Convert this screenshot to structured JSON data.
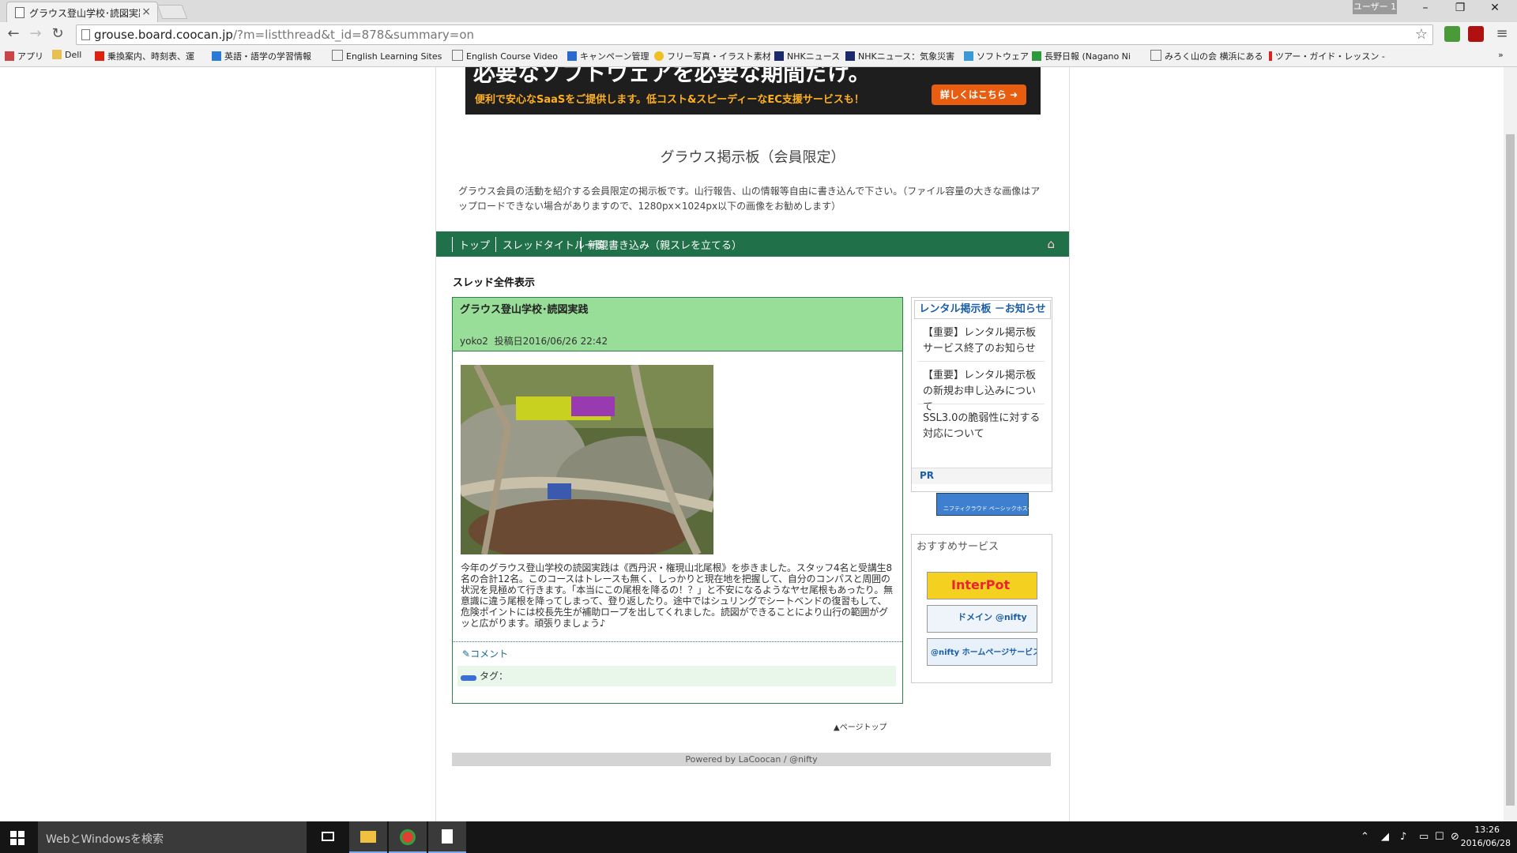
{
  "browser": {
    "tab_title": "グラウス登山学校･読図実践",
    "user_badge": "ユーザー 1",
    "url_host": "grouse.board.coocan.jp",
    "url_path": "/?m=listthread&t_id=878&summary=on",
    "bookmarks": [
      "アプリ",
      "Dell",
      "乗換案内、時刻表、運",
      "英語・語学の学習情報",
      "English Learning Sites",
      "English Course Video",
      "キャンペーン管理",
      "フリー写真・イラスト素材",
      "NHKニュース",
      "NHKニュース：気象災害",
      "ソフトウェア",
      "長野日報 (Nagano Ni",
      "みろく山の会 横浜にある",
      "ツアー・ガイド・レッスン -"
    ]
  },
  "banner": {
    "headline": "必要なソフトウェアを必要な期間だけ。",
    "sub": "便利で安心なSaaSをご提供します。低コスト&スピーディーなEC支援サービスも！",
    "button": "詳しくはこちら"
  },
  "board": {
    "title": "グラウス掲示板（会員限定）",
    "description": "グラウス会員の活動を紹介する会員限定の掲示板です。山行報告、山の情報等自由に書き込んで下さい。（ファイル容量の大きな画像はアップロードできない場合がありますので、1280px×1024px以下の画像をお勧めします）",
    "nav": [
      "トップ",
      "スレッドタイトル一覧",
      "新規書き込み（親スレを立てる）"
    ]
  },
  "section_title": "スレッド全件表示",
  "thread": {
    "title": "グラウス登山学校･読図実践",
    "author": "yoko2",
    "posted_label": "投稿日",
    "posted_at": "2016/06/26 22:42",
    "body": "今年のグラウス登山学校の読図実践は《西丹沢・権現山北尾根》を歩きました。スタッフ4名と受講生8名の合計12名。このコースはトレースも無く、しっかりと現在地を把握して、自分のコンパスと周囲の状況を見極めて行きます。「本当にこの尾根を降るの！？」と不安になるようなヤセ尾根もあったり。無意識に違う尾根を降ってしまって、登り返したり。途中ではシュリングでシートベンドの復習もして、危険ポイントには校長先生が補助ロープを出してくれました。読図ができることにより山行の範囲がグッと広がります。頑張りましょう♪",
    "comment_label": "コメント",
    "tag_label": "タグ："
  },
  "sidebar": {
    "notice_title": "レンタル掲示板 －お知らせ",
    "notices": [
      "【重要】レンタル掲示板サービス終了のお知らせ",
      "【重要】レンタル掲示板の新規お申し込みについて",
      "SSL3.0の脆弱性に対する対応について"
    ],
    "pr_label": "PR",
    "pr_banner": "ニフティクラウド ベーシックホスティング",
    "recommend_title": "おすすめサービス",
    "services": [
      "InterPot",
      "ドメイン @nifty",
      "@nifty ホームページサービス"
    ]
  },
  "page_top": "ページトップ",
  "footer": "Powered by LaCoocan / @nifty",
  "taskbar": {
    "search_placeholder": "WebとWindowsを検索",
    "time": "13:26",
    "date": "2016/06/28"
  }
}
